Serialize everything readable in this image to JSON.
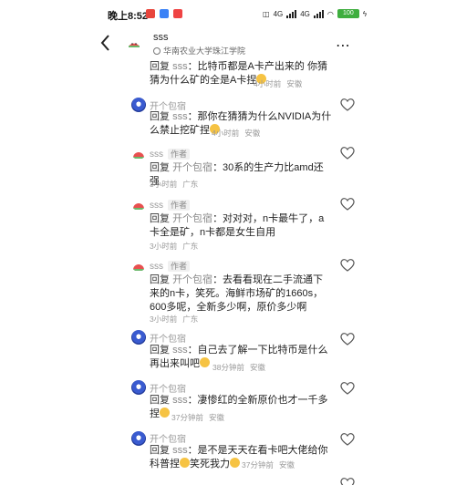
{
  "status_bar": {
    "time": "晚上8:52",
    "signal_labels": [
      "4G",
      "4G"
    ],
    "battery": "100",
    "app_icon_colors": [
      "#e8453c",
      "#3b82f6",
      "#ef4444"
    ]
  },
  "header": {
    "back_icon": "chevron-left-icon",
    "name": "sss",
    "school": "华南农业大学珠江学院",
    "more_icon": "more-dots-icon"
  },
  "colors": {
    "like_outline": "#555555",
    "meta_gray": "#999999",
    "author_badge_bg": "#f0f0f0",
    "avatar_blue": "#3a5bd0"
  },
  "comments": [
    {
      "author": "",
      "badge": "",
      "prefix": "回复",
      "reply_to": "sss",
      "text": "：比特币都是A卡产出来的 你猜猜为什么矿的全是A卡捏",
      "emoji": "😋",
      "time": "4小时前",
      "location": "安徽"
    },
    {
      "author": "开个包宿",
      "badge": "",
      "prefix": "回复",
      "reply_to": "sss",
      "text": "：那你在猜猜为什么NVIDIA为什么禁止挖矿捏",
      "emoji": "🤣",
      "time": "4小时前",
      "location": "安徽"
    },
    {
      "author": "sss",
      "badge": "作者",
      "prefix": "回复",
      "reply_to": "开个包宿",
      "text": "：30系的生产力比amd还强",
      "emoji": "",
      "time": "3小时前",
      "location": "广东"
    },
    {
      "author": "sss",
      "badge": "作者",
      "prefix": "回复",
      "reply_to": "开个包宿",
      "text": "：对对对，n卡最牛了，a卡全是矿，n卡都是女生自用",
      "emoji": "",
      "time": "3小时前",
      "location": "广东"
    },
    {
      "author": "sss",
      "badge": "作者",
      "prefix": "回复",
      "reply_to": "开个包宿",
      "text": "：去看看现在二手流通下来的n卡，笑死。海鲜市场矿的1660s，600多呢，全新多少啊，原价多少啊",
      "emoji": "",
      "time": "3小时前",
      "location": "广东"
    },
    {
      "author": "开个包宿",
      "badge": "",
      "prefix": "回复",
      "reply_to": "sss",
      "text": "：自己去了解一下比特币是什么再出来叫吧",
      "emoji": "😋",
      "time": "38分钟前",
      "location": "安徽"
    },
    {
      "author": "开个包宿",
      "badge": "",
      "prefix": "回复",
      "reply_to": "sss",
      "text": "：凄惨红的全新原价也才一千多捏",
      "emoji": "😋",
      "time": "37分钟前",
      "location": "安徽"
    },
    {
      "author": "开个包宿",
      "badge": "",
      "prefix": "回复",
      "reply_to": "sss",
      "text": "：是不是天天在看卡吧大佬给你科普捏",
      "emoji": "🤣",
      "text_tail": "笑死我力",
      "emoji_tail": "🤣",
      "time": "37分钟前",
      "location": "安徽"
    }
  ]
}
